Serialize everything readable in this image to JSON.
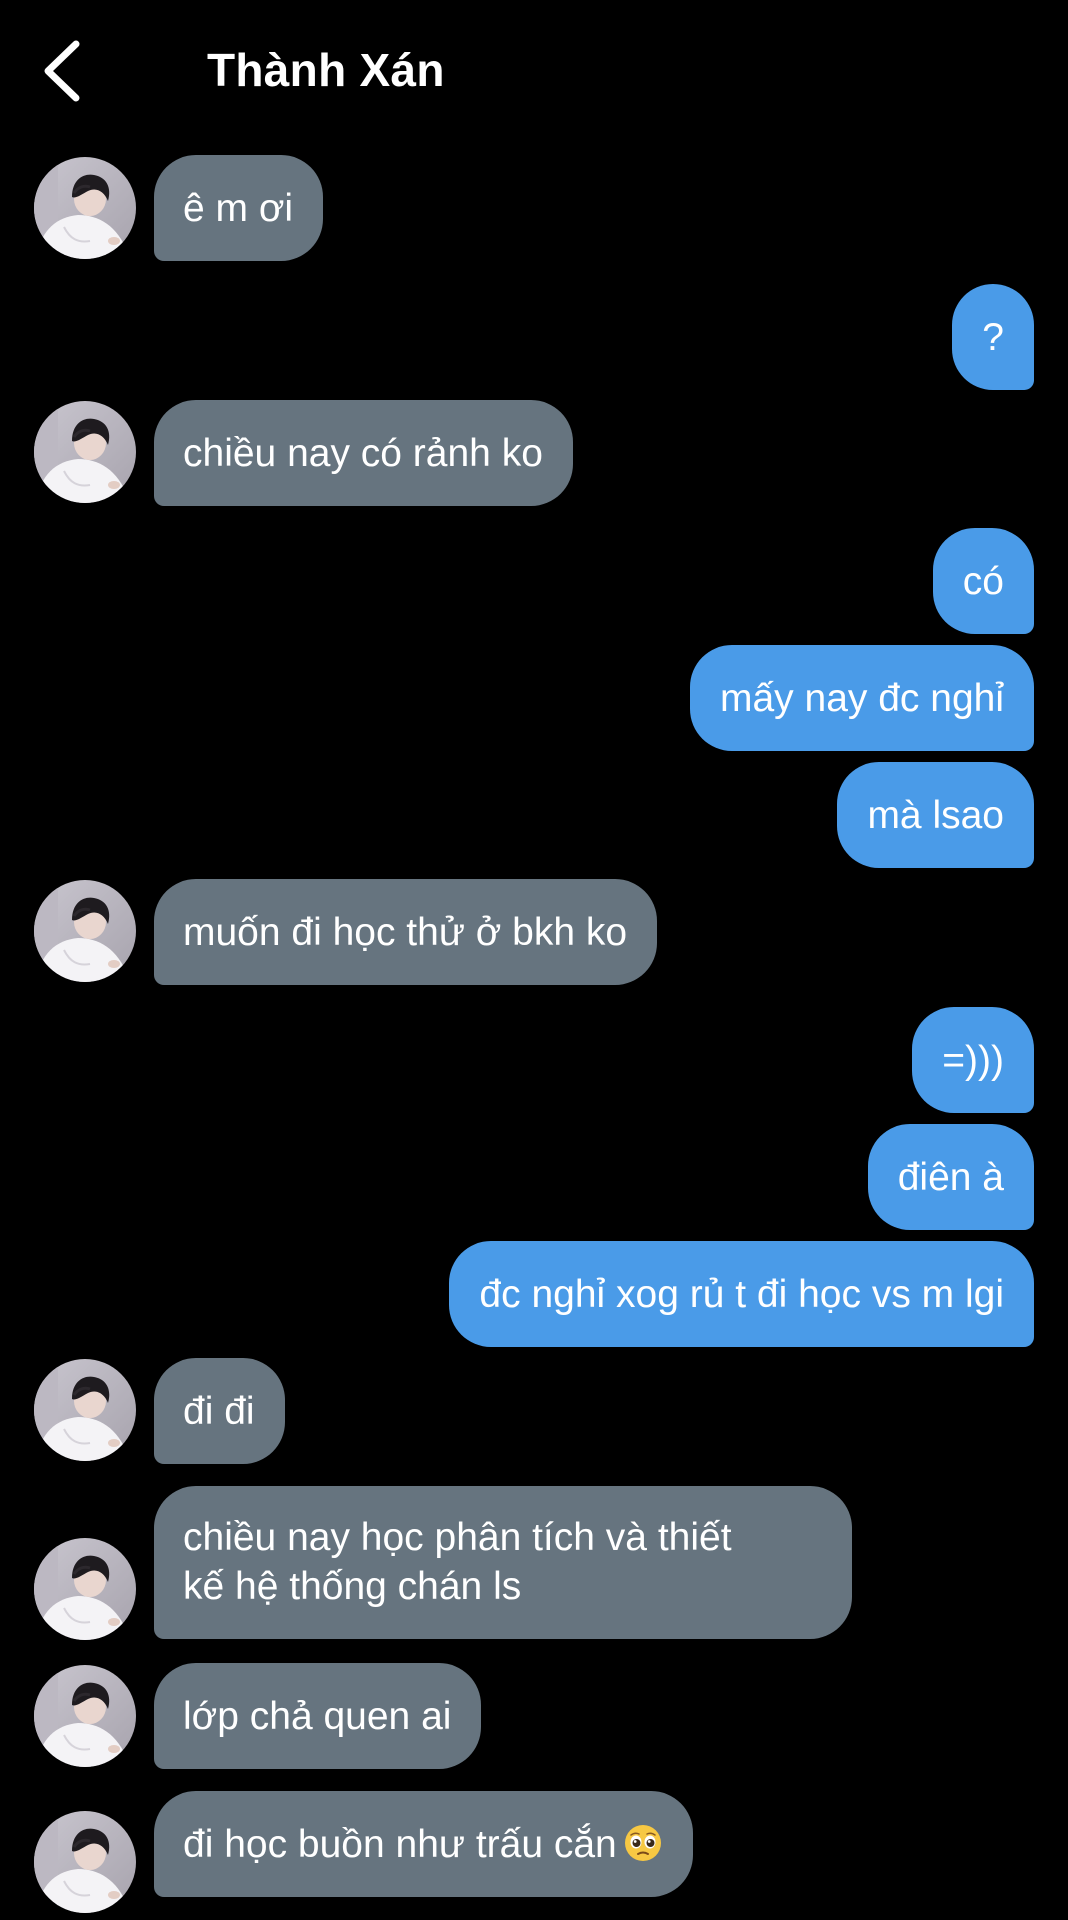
{
  "header": {
    "title": "Thành Xán"
  },
  "messages": {
    "m1": "ê m ơi",
    "m2": "?",
    "m3": "chiều nay có rảnh ko",
    "m4": "có",
    "m5": "mấy nay đc nghỉ",
    "m6": "mà lsao",
    "m7": "muốn đi học thử ở bkh ko",
    "m8": "=)))",
    "m9": "điên à",
    "m10": "đc nghỉ xog rủ t đi học vs m lgi",
    "m11": "đi đi",
    "m12_line1": "chiều nay học phân tích và thiết",
    "m12_line2": "kế hệ thống chán ls",
    "m13": "lớp chả quen ai",
    "m14": "đi học buồn như trấu cắn"
  },
  "icons": {
    "back": "chevron-left-icon",
    "emoji": "pleading-face-emoji"
  },
  "colors": {
    "background": "#000000",
    "incoming_bubble": "#66747f",
    "outgoing_bubble": "#4a9be8",
    "text": "#ffffff"
  }
}
